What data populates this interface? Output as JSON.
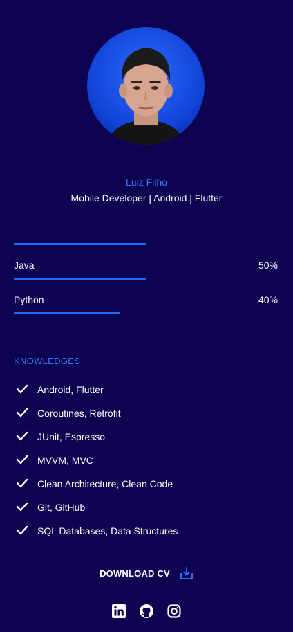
{
  "profile": {
    "name": "Luiz Filho",
    "role": "Mobile Developer | Android | Flutter"
  },
  "skills": [
    {
      "label": "Java",
      "percent_text": "50%",
      "level": 0.5
    },
    {
      "label": "Python",
      "percent_text": "40%",
      "level": 0.4
    }
  ],
  "knowledges": {
    "title": "KNOWLEDGES",
    "items": [
      "Android, Flutter",
      "Coroutines, Retrofit",
      "JUnit, Espresso",
      "MVVM, MVC",
      "Clean Architecture, Clean Code",
      "Git, GitHub",
      "SQL Databases, Data Structures"
    ]
  },
  "download": {
    "label": "DOWNLOAD CV",
    "icon": "download-icon"
  },
  "socials": [
    {
      "icon": "linkedin-icon"
    },
    {
      "icon": "github-icon"
    },
    {
      "icon": "instagram-icon"
    }
  ],
  "colors": {
    "background": "#0e0350",
    "accent": "#2f7bff",
    "bar": "#1f6bff"
  }
}
